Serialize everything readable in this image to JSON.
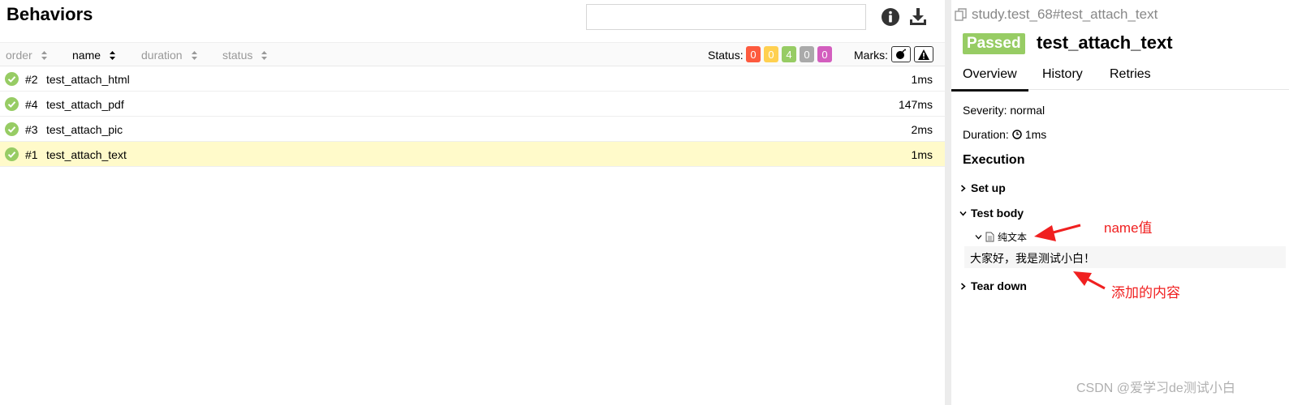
{
  "left": {
    "title": "Behaviors",
    "search": {
      "value": "",
      "placeholder": ""
    },
    "columns": [
      "order",
      "name",
      "duration",
      "status"
    ],
    "status_label": "Status:",
    "status_counts": [
      {
        "value": "0",
        "color": "#fd5a3e"
      },
      {
        "value": "0",
        "color": "#ffd050"
      },
      {
        "value": "4",
        "color": "#97cc64"
      },
      {
        "value": "0",
        "color": "#aaaaaa"
      },
      {
        "value": "0",
        "color": "#d35ebe"
      }
    ],
    "marks_label": "Marks:",
    "rows": [
      {
        "order": "#2",
        "name": "test_attach_html",
        "duration": "1ms"
      },
      {
        "order": "#4",
        "name": "test_attach_pdf",
        "duration": "147ms"
      },
      {
        "order": "#3",
        "name": "test_attach_pic",
        "duration": "2ms"
      },
      {
        "order": "#1",
        "name": "test_attach_text",
        "duration": "1ms"
      }
    ]
  },
  "right": {
    "breadcrumb": "study.test_68#test_attach_text",
    "status_badge": "Passed",
    "test_title": "test_attach_text",
    "tabs": [
      "Overview",
      "History",
      "Retries"
    ],
    "severity": "Severity: normal",
    "duration_label": "Duration:",
    "duration_value": "1ms",
    "execution_title": "Execution",
    "steps": {
      "setup": "Set up",
      "body": "Test body",
      "teardown": "Tear down"
    },
    "attachment_name": "纯文本",
    "attachment_content": "大家好，我是测试小白！"
  },
  "annotations": {
    "name_note": "name值",
    "content_note": "添加的内容"
  },
  "watermark": "CSDN @爱学习de测试小白",
  "colors": {
    "passed": "#97cc64",
    "selected_row": "#fffaca",
    "annotation": "#f02020"
  }
}
